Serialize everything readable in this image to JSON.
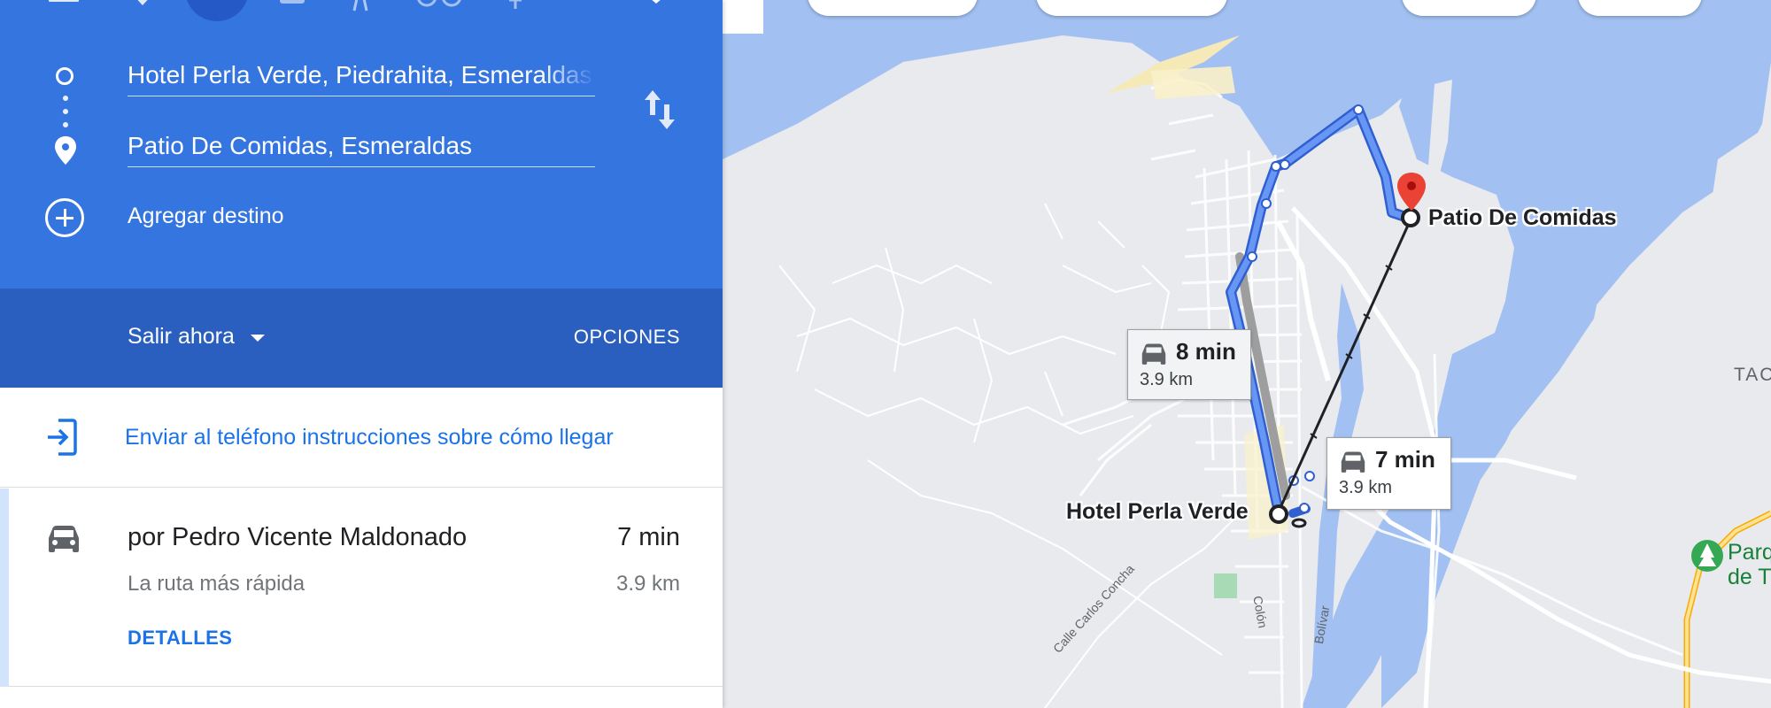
{
  "directions": {
    "origin_value": "Hotel Perla Verde, Piedrahita, Esmeraldas",
    "destination_value": "Patio De Comidas, Esmeraldas",
    "add_destination_label": "Agregar destino",
    "depart_label": "Salir ahora",
    "options_label": "OPCIONES",
    "send_to_phone_label": "Enviar al teléfono instrucciones sobre cómo llegar",
    "active_mode_icon": "car-icon",
    "accent_color": "#3575e0"
  },
  "routes": [
    {
      "name": "por Pedro Vicente Maldonado",
      "duration": "7 min",
      "subtitle": "La ruta más rápida",
      "distance": "3.9 km",
      "details_label": "DETALLES"
    }
  ],
  "map": {
    "origin_label": "Hotel Perla Verde",
    "destination_label": "Patio De Comidas",
    "primary_route": {
      "duration": "7 min",
      "distance": "3.9 km",
      "color": "#4a80f5"
    },
    "alternate_route": {
      "duration": "8 min",
      "distance": "3.9 km",
      "color": "#9e9e9e"
    },
    "streets": [
      "Calle Carlos Concha",
      "Colón",
      "Bolívar"
    ],
    "edge_label": "TAC",
    "park_label": "Parq\nde T",
    "water_color": "#a2c1f2",
    "pin_color": "#ea4335"
  }
}
